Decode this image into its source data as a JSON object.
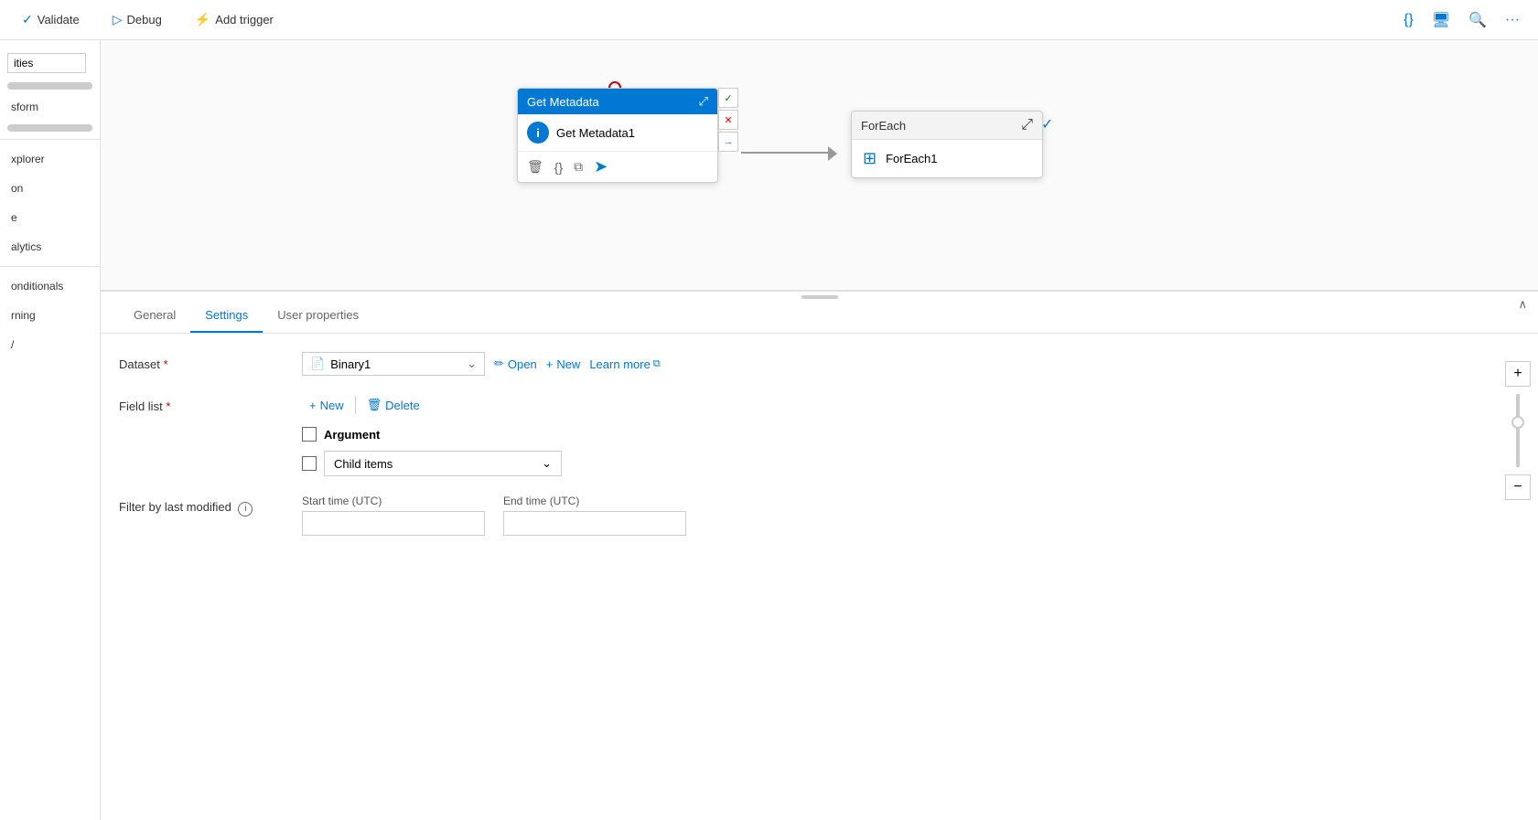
{
  "toolbar": {
    "validate_label": "Validate",
    "debug_label": "Debug",
    "add_trigger_label": "Add trigger"
  },
  "sidebar": {
    "search_placeholder": "ities",
    "items": [
      {
        "label": "sform"
      },
      {
        "label": ""
      },
      {
        "label": ""
      },
      {
        "label": "xplorer"
      },
      {
        "label": "on"
      },
      {
        "label": "e"
      },
      {
        "label": "alytics"
      },
      {
        "label": ""
      },
      {
        "label": "onditionals"
      },
      {
        "label": "rning"
      },
      {
        "label": "/"
      }
    ]
  },
  "canvas": {
    "get_metadata_node": {
      "title": "Get Metadata",
      "body_label": "Get Metadata1"
    },
    "foreach_node": {
      "title": "ForEach",
      "body_label": "ForEach1"
    }
  },
  "panel": {
    "tabs": [
      {
        "label": "General"
      },
      {
        "label": "Settings"
      },
      {
        "label": "User properties"
      }
    ],
    "active_tab": "Settings",
    "dataset": {
      "label": "Dataset",
      "required": true,
      "value": "Binary1",
      "open_label": "Open",
      "new_label": "New",
      "learn_more_label": "Learn more"
    },
    "field_list": {
      "label": "Field list",
      "required": true,
      "new_label": "New",
      "delete_label": "Delete",
      "argument_label": "Argument",
      "child_items_label": "Child items"
    },
    "filter": {
      "label": "Filter by last modified",
      "start_time_label": "Start time (UTC)",
      "end_time_label": "End time (UTC)",
      "start_time_value": "",
      "end_time_value": ""
    }
  }
}
